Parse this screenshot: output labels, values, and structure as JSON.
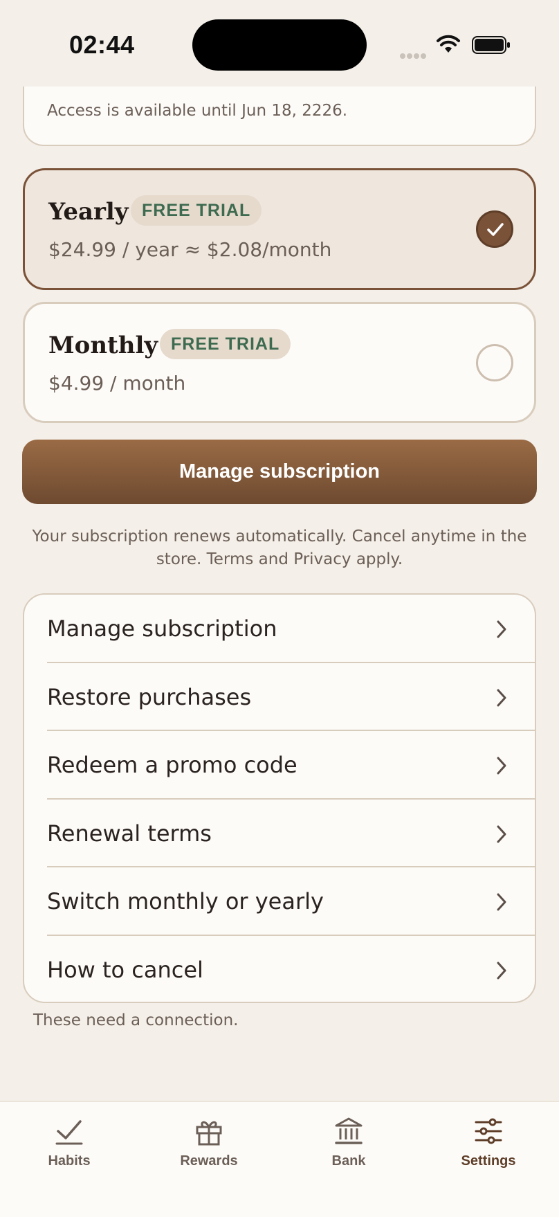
{
  "status_bar": {
    "time": "02:44"
  },
  "access": {
    "text": "Access is available until Jun 18, 2226."
  },
  "plans": [
    {
      "name": "Yearly",
      "badge": "FREE TRIAL",
      "price": "$24.99 / year ≈ $2.08/month",
      "selected": true
    },
    {
      "name": "Monthly",
      "badge": "FREE TRIAL",
      "price": "$4.99 / month",
      "selected": false
    }
  ],
  "cta": {
    "label": "Manage subscription"
  },
  "fine_print": "Your subscription renews automatically. Cancel anytime in the store. Terms and Privacy apply.",
  "list": {
    "items": [
      {
        "label": "Manage subscription"
      },
      {
        "label": "Restore purchases"
      },
      {
        "label": "Redeem a promo code"
      },
      {
        "label": "Renewal terms"
      },
      {
        "label": "Switch monthly or yearly"
      },
      {
        "label": "How to cancel"
      }
    ]
  },
  "footnote": "These need a connection.",
  "tabs": [
    {
      "label": "Habits",
      "icon": "checkmark-icon"
    },
    {
      "label": "Rewards",
      "icon": "gift-icon"
    },
    {
      "label": "Bank",
      "icon": "bank-icon"
    },
    {
      "label": "Settings",
      "icon": "sliders-icon",
      "active": true
    }
  ],
  "colors": {
    "accent": "#7a5238",
    "badge_text": "#3e6b50",
    "background": "#f4efe8"
  }
}
